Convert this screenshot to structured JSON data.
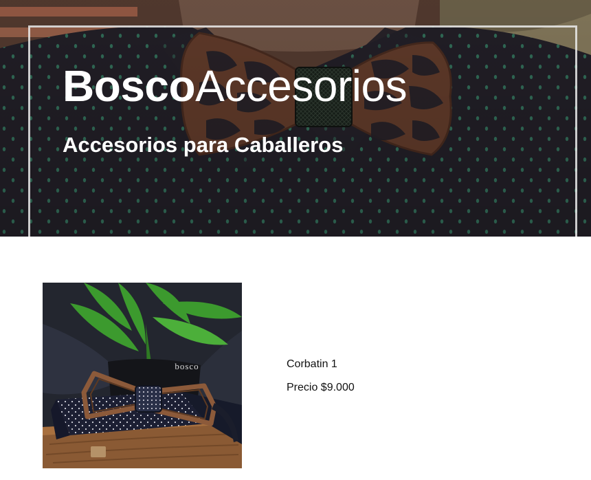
{
  "hero": {
    "brand_bold": "Bosco",
    "brand_light": "Accesorios",
    "tagline": "Accesorios para Caballeros"
  },
  "products": [
    {
      "name": "Corbatin 1",
      "price_label": "Precio $9.000",
      "image_logo_text": "bosco"
    }
  ],
  "colors": {
    "hero_text": "#ffffff",
    "shirt": "#2b2731",
    "shirt_dot": "#3f8a70",
    "wood": "#7a4a35",
    "frame": "#ebebeb",
    "body_text": "#111111"
  }
}
